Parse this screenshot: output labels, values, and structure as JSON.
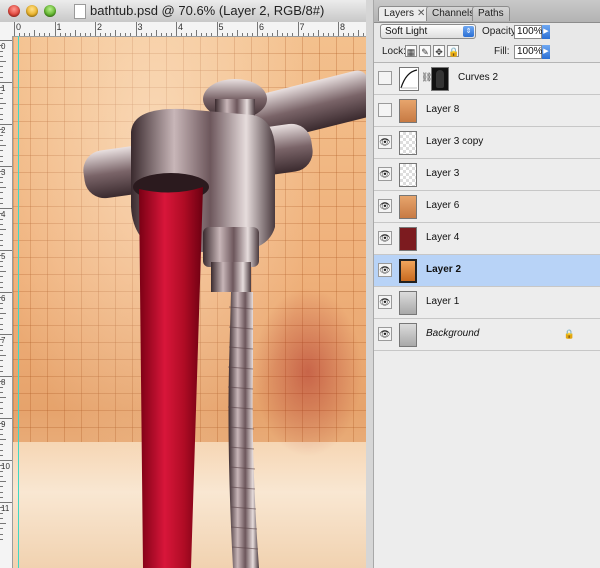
{
  "document": {
    "title": "bathtub.psd @ 70.6% (Layer 2, RGB/8#)",
    "ruler_top_numbers": [
      "0",
      "1",
      "2",
      "3",
      "4",
      "5",
      "6",
      "7",
      "8"
    ],
    "ruler_left_numbers": [
      "0",
      "1",
      "2",
      "3",
      "4",
      "5",
      "6",
      "7",
      "8",
      "9",
      "10",
      "11"
    ]
  },
  "panel": {
    "tabs": [
      {
        "label": "Layers"
      },
      {
        "label": "Channels"
      },
      {
        "label": "Paths"
      }
    ],
    "blend_mode": "Soft Light",
    "opacity_label": "Opacity:",
    "opacity_value": "100%",
    "lock_label": "Lock:",
    "fill_label": "Fill:",
    "fill_value": "100%"
  },
  "layers": [
    {
      "name": "Curves 2",
      "visible": false,
      "type": "adjustment"
    },
    {
      "name": "Layer 8",
      "visible": false,
      "type": "photo"
    },
    {
      "name": "Layer 3 copy",
      "visible": true,
      "type": "checker"
    },
    {
      "name": "Layer 3",
      "visible": true,
      "type": "checker"
    },
    {
      "name": "Layer 6",
      "visible": true,
      "type": "photo"
    },
    {
      "name": "Layer 4",
      "visible": true,
      "type": "red"
    },
    {
      "name": "Layer 2",
      "visible": true,
      "type": "orange",
      "selected": true
    },
    {
      "name": "Layer 1",
      "visible": true,
      "type": "gray"
    },
    {
      "name": "Background",
      "visible": true,
      "type": "background",
      "locked": true
    }
  ],
  "colors": {
    "water": "#c0102a",
    "selection": "#b8d3f7",
    "accent_blue": "#2a6fd4"
  }
}
